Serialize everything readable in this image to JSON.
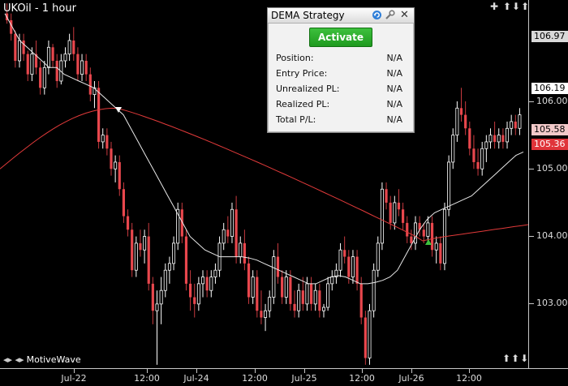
{
  "chart": {
    "title": "UKOil - 1 hour",
    "brand": "MotiveWave",
    "brand_arrows": "◂▸ ◂▸",
    "nav_top": "✚ ⬆⬇⬆",
    "nav_bottom": "⬆⬆⬇"
  },
  "y_axis": {
    "ticks": [
      "106.00",
      "105.00",
      "104.00",
      "103.00"
    ],
    "badges": [
      {
        "label": "106.97",
        "bg": "#d9d9d9",
        "fg": "#000000"
      },
      {
        "label": "106.19",
        "bg": "#ffffff",
        "fg": "#000000"
      },
      {
        "label": "105.58",
        "bg": "#f2c9c9",
        "fg": "#000000"
      },
      {
        "label": "105.36",
        "bg": "#e0343a",
        "fg": "#ffffff"
      }
    ]
  },
  "x_axis": {
    "ticks": [
      "Jul-22",
      "12:00",
      "Jul-24",
      "12:00",
      "Jul-25",
      "12:00",
      "Jul-26",
      "12:00"
    ]
  },
  "strategy_panel": {
    "title": "DEMA Strategy",
    "activate_label": "Activate",
    "refresh_icon": "refresh-icon",
    "settings_icon": "wrench-icon",
    "close_icon": "close-icon",
    "rows": [
      {
        "label": "Position:",
        "value": "N/A"
      },
      {
        "label": "Entry Price:",
        "value": "N/A"
      },
      {
        "label": "Unrealized PL:",
        "value": "N/A"
      },
      {
        "label": "Realized PL:",
        "value": "N/A"
      },
      {
        "label": "Total P/L:",
        "value": "N/A"
      }
    ]
  },
  "colors": {
    "bull": "#ffffff",
    "bear": "#e8474d",
    "fast_ma": "#e8e8e8",
    "slow_ma": "#e23a3a",
    "activate": "#2aad2a"
  },
  "chart_data": {
    "type": "candlestick",
    "title": "UKOil - 1 hour",
    "y_range": [
      102.05,
      107.5
    ],
    "candles": [
      [
        107.3,
        107.45,
        107.15,
        107.2
      ],
      [
        107.2,
        107.3,
        106.9,
        107.0
      ],
      [
        107.0,
        107.05,
        106.5,
        106.6
      ],
      [
        106.6,
        107.0,
        106.5,
        106.9
      ],
      [
        106.9,
        107.0,
        106.6,
        106.7
      ],
      [
        106.7,
        106.75,
        106.3,
        106.4
      ],
      [
        106.4,
        106.8,
        106.3,
        106.7
      ],
      [
        106.7,
        106.9,
        106.4,
        106.5
      ],
      [
        106.5,
        106.6,
        106.1,
        106.2
      ],
      [
        106.2,
        106.6,
        106.1,
        106.5
      ],
      [
        106.5,
        106.9,
        106.4,
        106.8
      ],
      [
        106.8,
        106.85,
        106.5,
        106.6
      ],
      [
        106.6,
        106.7,
        106.2,
        106.3
      ],
      [
        106.3,
        106.7,
        106.25,
        106.6
      ],
      [
        106.6,
        106.8,
        106.5,
        106.7
      ],
      [
        106.7,
        107.0,
        106.6,
        106.9
      ],
      [
        106.9,
        107.1,
        106.6,
        106.7
      ],
      [
        106.7,
        106.8,
        106.3,
        106.4
      ],
      [
        106.4,
        106.7,
        106.3,
        106.6
      ],
      [
        106.6,
        106.7,
        106.3,
        106.4
      ],
      [
        106.4,
        106.5,
        106.0,
        106.1
      ],
      [
        106.1,
        106.3,
        105.9,
        106.2
      ],
      [
        106.2,
        106.3,
        105.3,
        105.4
      ],
      [
        105.4,
        105.6,
        105.3,
        105.5
      ],
      [
        105.5,
        105.6,
        105.2,
        105.3
      ],
      [
        105.3,
        105.4,
        104.9,
        105.0
      ],
      [
        105.0,
        105.2,
        104.8,
        105.1
      ],
      [
        105.1,
        105.2,
        104.6,
        104.7
      ],
      [
        104.7,
        104.8,
        104.2,
        104.3
      ],
      [
        104.3,
        104.4,
        104.0,
        104.1
      ],
      [
        104.1,
        104.2,
        103.4,
        103.5
      ],
      [
        103.5,
        104.0,
        103.4,
        103.9
      ],
      [
        103.9,
        104.1,
        103.7,
        103.8
      ],
      [
        103.8,
        104.1,
        103.6,
        104.0
      ],
      [
        104.0,
        104.2,
        103.2,
        103.3
      ],
      [
        103.3,
        103.4,
        102.7,
        102.9
      ],
      [
        102.9,
        103.2,
        102.1,
        103.0
      ],
      [
        103.0,
        103.4,
        102.7,
        103.2
      ],
      [
        103.2,
        103.6,
        103.1,
        103.5
      ],
      [
        103.5,
        103.7,
        103.3,
        103.6
      ],
      [
        103.6,
        104.0,
        103.5,
        103.9
      ],
      [
        103.9,
        104.5,
        103.8,
        104.4
      ],
      [
        104.4,
        104.5,
        103.9,
        104.0
      ],
      [
        104.0,
        104.1,
        103.2,
        103.3
      ],
      [
        103.3,
        103.5,
        102.9,
        103.1
      ],
      [
        103.1,
        103.3,
        102.8,
        103.0
      ],
      [
        103.0,
        103.4,
        102.9,
        103.3
      ],
      [
        103.3,
        103.5,
        103.1,
        103.4
      ],
      [
        103.4,
        103.5,
        103.1,
        103.2
      ],
      [
        103.2,
        103.5,
        103.1,
        103.4
      ],
      [
        103.4,
        103.6,
        103.3,
        103.5
      ],
      [
        103.5,
        104.0,
        103.4,
        103.9
      ],
      [
        103.9,
        104.2,
        103.8,
        104.1
      ],
      [
        104.1,
        104.3,
        103.9,
        104.0
      ],
      [
        104.0,
        104.5,
        103.9,
        104.4
      ],
      [
        104.4,
        104.6,
        103.6,
        103.7
      ],
      [
        103.7,
        104.0,
        103.6,
        103.9
      ],
      [
        103.9,
        104.1,
        103.5,
        103.6
      ],
      [
        103.6,
        103.7,
        103.0,
        103.1
      ],
      [
        103.1,
        103.5,
        103.0,
        103.4
      ],
      [
        103.4,
        103.5,
        102.8,
        102.9
      ],
      [
        102.9,
        103.2,
        102.7,
        102.8
      ],
      [
        102.8,
        103.0,
        102.6,
        102.9
      ],
      [
        102.9,
        103.2,
        102.8,
        103.1
      ],
      [
        103.1,
        103.8,
        103.0,
        103.7
      ],
      [
        103.7,
        103.9,
        103.3,
        103.4
      ],
      [
        103.4,
        103.5,
        103.0,
        103.1
      ],
      [
        103.1,
        103.5,
        103.0,
        103.4
      ],
      [
        103.4,
        103.5,
        102.9,
        103.0
      ],
      [
        103.0,
        103.2,
        102.8,
        102.9
      ],
      [
        102.9,
        103.3,
        102.8,
        103.2
      ],
      [
        103.2,
        103.4,
        102.9,
        103.0
      ],
      [
        103.0,
        103.4,
        102.9,
        103.3
      ],
      [
        103.3,
        103.4,
        102.9,
        103.0
      ],
      [
        103.0,
        103.3,
        102.9,
        103.2
      ],
      [
        103.2,
        103.3,
        102.8,
        102.9
      ],
      [
        102.9,
        103.0,
        102.8,
        102.95
      ],
      [
        102.95,
        103.4,
        102.9,
        103.3
      ],
      [
        103.3,
        103.5,
        103.2,
        103.4
      ],
      [
        103.4,
        103.6,
        103.3,
        103.5
      ],
      [
        103.5,
        103.9,
        103.4,
        103.8
      ],
      [
        103.8,
        104.0,
        103.6,
        103.7
      ],
      [
        103.7,
        103.8,
        103.3,
        103.4
      ],
      [
        103.4,
        103.8,
        103.3,
        103.7
      ],
      [
        103.7,
        103.8,
        103.2,
        103.3
      ],
      [
        103.3,
        103.4,
        102.7,
        102.8
      ],
      [
        102.8,
        102.9,
        102.1,
        102.2
      ],
      [
        102.2,
        103.0,
        102.1,
        102.9
      ],
      [
        102.9,
        103.6,
        102.8,
        103.5
      ],
      [
        103.5,
        104.0,
        103.4,
        103.9
      ],
      [
        103.9,
        104.8,
        103.8,
        104.7
      ],
      [
        104.7,
        104.8,
        104.4,
        104.5
      ],
      [
        104.5,
        104.6,
        104.1,
        104.2
      ],
      [
        104.2,
        104.6,
        104.1,
        104.5
      ],
      [
        104.5,
        104.7,
        104.3,
        104.4
      ],
      [
        104.4,
        104.5,
        104.1,
        104.2
      ],
      [
        104.2,
        104.3,
        103.9,
        104.0
      ],
      [
        104.0,
        104.1,
        103.8,
        103.9
      ],
      [
        103.9,
        104.3,
        103.8,
        104.2
      ],
      [
        104.2,
        104.3,
        104.0,
        104.1
      ],
      [
        104.1,
        104.2,
        103.9,
        104.0
      ],
      [
        104.0,
        104.3,
        103.9,
        104.2
      ],
      [
        104.2,
        104.3,
        103.7,
        103.8
      ],
      [
        103.8,
        104.0,
        103.6,
        103.9
      ],
      [
        103.9,
        104.0,
        103.5,
        103.6
      ],
      [
        103.6,
        104.5,
        103.5,
        104.4
      ],
      [
        104.4,
        105.2,
        104.3,
        105.1
      ],
      [
        105.1,
        105.6,
        105.0,
        105.5
      ],
      [
        105.5,
        106.0,
        105.4,
        105.9
      ],
      [
        105.9,
        106.2,
        105.7,
        105.8
      ],
      [
        105.8,
        106.0,
        105.5,
        105.6
      ],
      [
        105.6,
        105.7,
        105.2,
        105.3
      ],
      [
        105.3,
        105.5,
        105.0,
        105.1
      ],
      [
        105.1,
        105.3,
        104.9,
        105.0
      ],
      [
        105.0,
        105.4,
        104.9,
        105.3
      ],
      [
        105.3,
        105.5,
        105.1,
        105.4
      ],
      [
        105.4,
        105.6,
        105.3,
        105.5
      ],
      [
        105.5,
        105.7,
        105.3,
        105.4
      ],
      [
        105.4,
        105.6,
        105.3,
        105.5
      ],
      [
        105.5,
        105.6,
        105.3,
        105.4
      ],
      [
        105.4,
        105.7,
        105.3,
        105.6
      ],
      [
        105.6,
        105.8,
        105.5,
        105.7
      ],
      [
        105.7,
        105.8,
        105.5,
        105.6
      ],
      [
        105.6,
        105.9,
        105.5,
        105.8
      ]
    ],
    "series": [
      {
        "name": "fast",
        "values": [
          107.3,
          107.1,
          106.9,
          106.8,
          106.7,
          106.6,
          106.5,
          106.5,
          106.4,
          106.35,
          106.3,
          106.25,
          106.2,
          106.1,
          106.0,
          105.9,
          105.8,
          105.6,
          105.4,
          105.2,
          105.0,
          104.8,
          104.6,
          104.4,
          104.2,
          104.0,
          103.9,
          103.8,
          103.75,
          103.7,
          103.7,
          103.7,
          103.7,
          103.68,
          103.65,
          103.6,
          103.55,
          103.5,
          103.45,
          103.4,
          103.35,
          103.3,
          103.3,
          103.35,
          103.4,
          103.42,
          103.4,
          103.35,
          103.3,
          103.3,
          103.32,
          103.35,
          103.4,
          103.5,
          103.7,
          103.9,
          104.1,
          104.25,
          104.35,
          104.4,
          104.45,
          104.5,
          104.55,
          104.6,
          104.7,
          104.8,
          104.9,
          105.0,
          105.1,
          105.2,
          105.25
        ]
      }
    ]
  }
}
